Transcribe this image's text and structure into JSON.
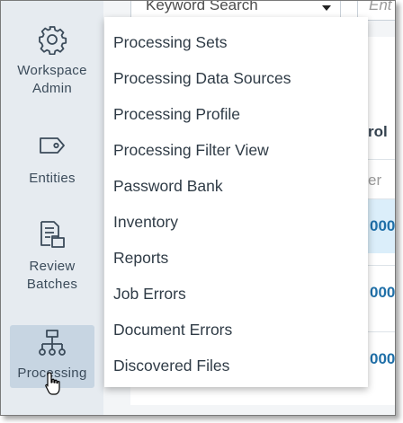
{
  "search": {
    "selected": "Keyword Search",
    "placeholder": "Ent"
  },
  "sidebar": {
    "items": [
      {
        "label_lines": [
          "Workspace",
          "Admin"
        ],
        "icon": "gear-icon",
        "active": false
      },
      {
        "label_lines": [
          "Entities"
        ],
        "icon": "tag-icon",
        "active": false
      },
      {
        "label_lines": [
          "Review",
          "Batches"
        ],
        "icon": "batch-documents-icon",
        "active": false
      },
      {
        "label_lines": [
          "Processing"
        ],
        "icon": "hierarchy-icon",
        "active": true
      }
    ]
  },
  "menu": {
    "items": [
      "Processing Sets",
      "Processing Data Sources",
      "Processing Profile",
      "Processing Filter View",
      "Password Bank",
      "Inventory",
      "Reports",
      "Job Errors",
      "Document Errors",
      "Discovered Files"
    ]
  },
  "table": {
    "header_fragment": "rol",
    "filter_placeholder_fragment": "er",
    "row_values": [
      "000",
      "000",
      "000"
    ]
  },
  "colors": {
    "sidebar_bg": "#e6ebf0",
    "active_item": "#c7d5e2",
    "link": "#1f6fa8"
  }
}
